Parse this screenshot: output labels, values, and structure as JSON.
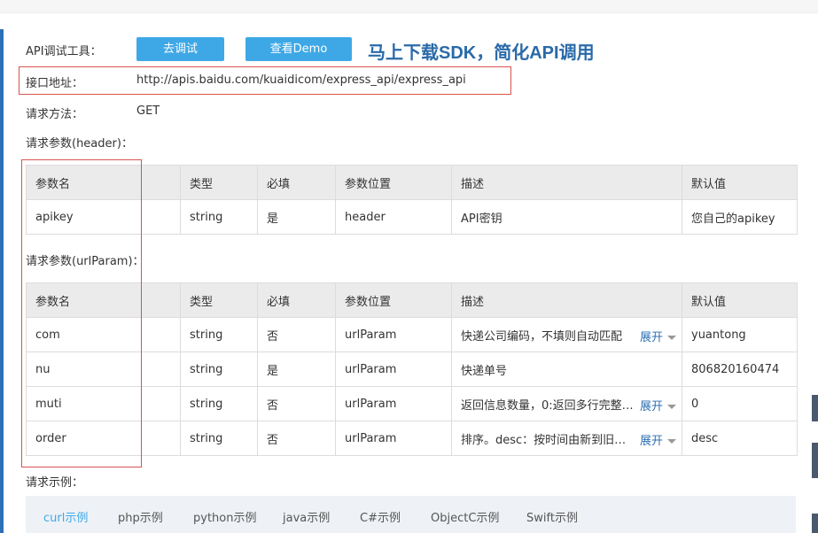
{
  "labels": {
    "api_tool": "API调试工具：",
    "endpoint": "接口地址：",
    "method": "请求方法：",
    "header_params": "请求参数(header)：",
    "url_params": "请求参数(urlParam)：",
    "example": "请求示例："
  },
  "buttons": {
    "debug": "去调试",
    "demo": "查看Demo"
  },
  "slogan": "马上下载SDK，简化API调用",
  "endpoint_url": "http://apis.baidu.com/kuaidicom/express_api/express_api",
  "method_value": "GET",
  "table_headers": [
    "参数名",
    "类型",
    "必填",
    "参数位置",
    "描述",
    "默认值"
  ],
  "expand_label": "展开",
  "header_rows": [
    {
      "name": "apikey",
      "type": "string",
      "required": "是",
      "position": "header",
      "desc": "API密钥",
      "default": "您自己的apikey"
    }
  ],
  "url_rows": [
    {
      "name": "com",
      "type": "string",
      "required": "否",
      "position": "urlParam",
      "desc": "快递公司编码，不填则自动匹配",
      "default": "yuantong"
    },
    {
      "name": "nu",
      "type": "string",
      "required": "是",
      "position": "urlParam",
      "desc": "快递单号",
      "default": "806820160474"
    },
    {
      "name": "muti",
      "type": "string",
      "required": "否",
      "position": "urlParam",
      "desc": "返回信息数量，0:返回多行完整的...",
      "default": "0"
    },
    {
      "name": "order",
      "type": "string",
      "required": "否",
      "position": "urlParam",
      "desc": "排序。desc：按时间由新到旧排...",
      "default": "desc"
    }
  ],
  "example_tabs": [
    "curl示例",
    "php示例",
    "python示例",
    "java示例",
    "C#示例",
    "ObjectC示例",
    "Swift示例"
  ],
  "colors": {
    "accent": "#3ea8e6",
    "link": "#2e6fb5",
    "highlight": "#d9534f"
  }
}
